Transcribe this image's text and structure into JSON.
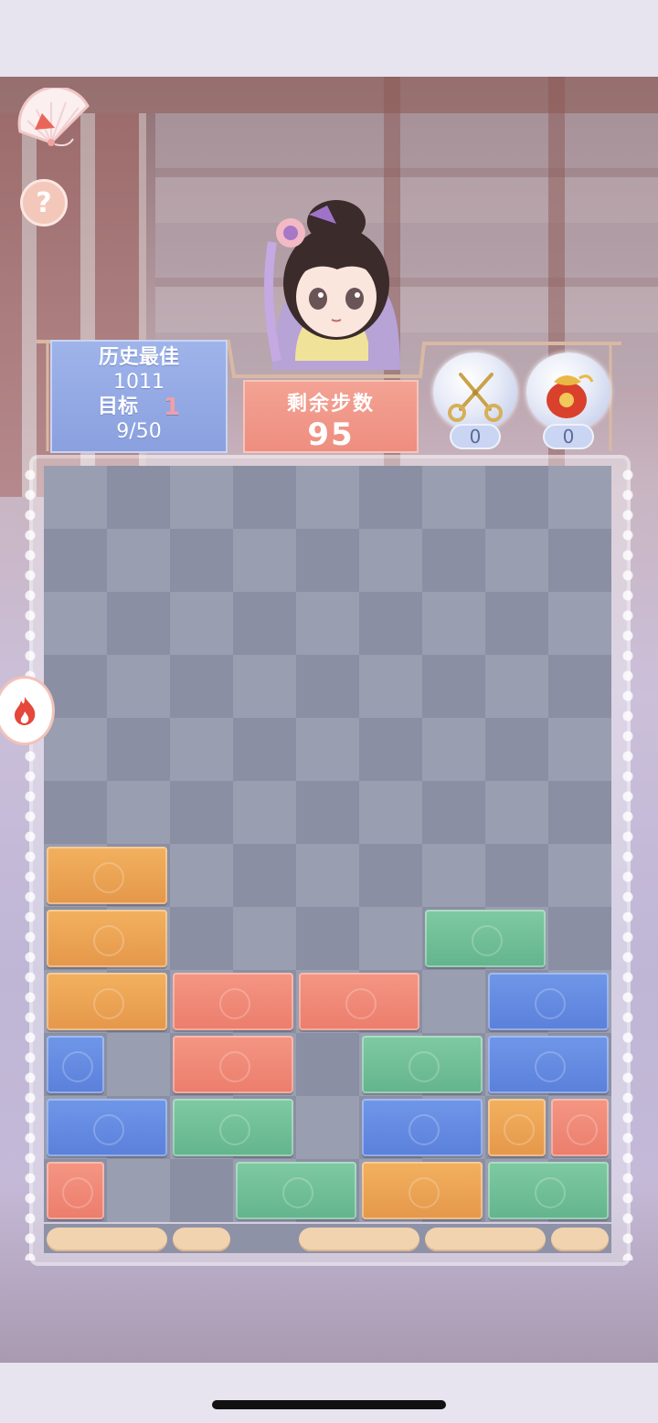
{
  "hud": {
    "best_label": "历史最佳",
    "best_score": "1011",
    "target_label": "目标",
    "target_count": "1",
    "target_progress": "9/50",
    "steps_label": "剩余步数",
    "steps_remaining": "95"
  },
  "tools": [
    {
      "name": "scissors",
      "count": "0"
    },
    {
      "name": "lucky-bag",
      "count": "0"
    }
  ],
  "board": {
    "columns": 9,
    "rows": 12,
    "blocks": [
      {
        "row": 6,
        "col": 0,
        "span": 2,
        "color": "orange"
      },
      {
        "row": 7,
        "col": 0,
        "span": 2,
        "color": "orange"
      },
      {
        "row": 7,
        "col": 6,
        "span": 2,
        "color": "green"
      },
      {
        "row": 8,
        "col": 0,
        "span": 2,
        "color": "orange"
      },
      {
        "row": 8,
        "col": 2,
        "span": 2,
        "color": "red"
      },
      {
        "row": 8,
        "col": 4,
        "span": 2,
        "color": "red"
      },
      {
        "row": 8,
        "col": 7,
        "span": 2,
        "color": "blue"
      },
      {
        "row": 9,
        "col": 0,
        "span": 1,
        "color": "blue"
      },
      {
        "row": 9,
        "col": 2,
        "span": 2,
        "color": "red"
      },
      {
        "row": 9,
        "col": 5,
        "span": 2,
        "color": "green"
      },
      {
        "row": 9,
        "col": 7,
        "span": 2,
        "color": "blue"
      },
      {
        "row": 10,
        "col": 0,
        "span": 2,
        "color": "blue"
      },
      {
        "row": 10,
        "col": 2,
        "span": 2,
        "color": "green"
      },
      {
        "row": 10,
        "col": 5,
        "span": 2,
        "color": "blue"
      },
      {
        "row": 10,
        "col": 7,
        "span": 1,
        "color": "orange"
      },
      {
        "row": 10,
        "col": 8,
        "span": 1,
        "color": "red"
      },
      {
        "row": 11,
        "col": 0,
        "span": 1,
        "color": "red"
      },
      {
        "row": 11,
        "col": 3,
        "span": 2,
        "color": "green"
      },
      {
        "row": 11,
        "col": 5,
        "span": 2,
        "color": "orange"
      },
      {
        "row": 11,
        "col": 7,
        "span": 2,
        "color": "green"
      }
    ],
    "next_row_preview": [
      {
        "col": 0,
        "span": 2
      },
      {
        "col": 2,
        "span": 1
      },
      {
        "col": 4,
        "span": 2
      },
      {
        "col": 6,
        "span": 2
      },
      {
        "col": 8,
        "span": 1
      }
    ]
  },
  "icons": {
    "menu": "fan-icon",
    "help": "question-icon",
    "power_up": "fire-icon"
  },
  "colors": {
    "orange": "#e9a052",
    "red": "#f08877",
    "green": "#6fbe97",
    "blue": "#648ae0"
  }
}
